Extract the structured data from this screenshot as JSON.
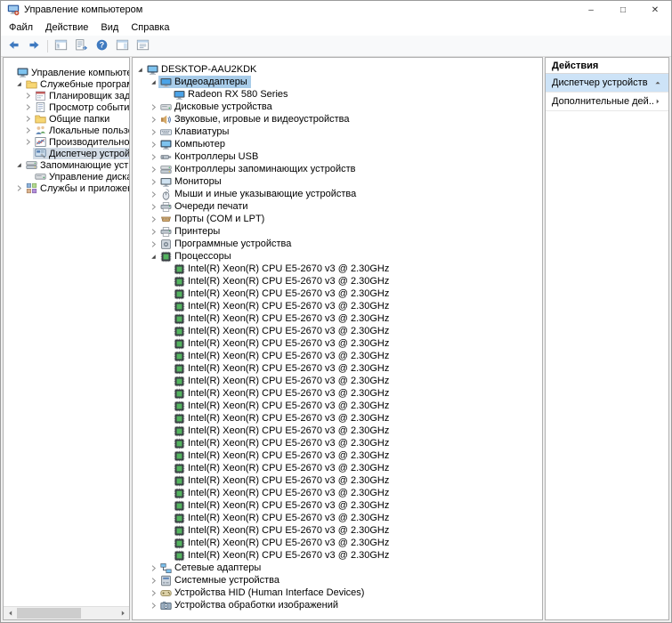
{
  "window": {
    "title": "Управление компьютером",
    "controls": {
      "minimize": "–",
      "maximize": "□",
      "close": "✕"
    }
  },
  "menubar": {
    "items": [
      {
        "name": "file",
        "label": "Файл"
      },
      {
        "name": "action",
        "label": "Действие"
      },
      {
        "name": "view",
        "label": "Вид"
      },
      {
        "name": "help",
        "label": "Справка"
      }
    ]
  },
  "toolbar": {
    "buttons": [
      {
        "name": "back",
        "icon": "arrow-left"
      },
      {
        "name": "forward",
        "icon": "arrow-right"
      },
      {
        "name": "show-console-tree",
        "icon": "window-tree"
      },
      {
        "name": "export-list",
        "icon": "export-list"
      },
      {
        "name": "help",
        "icon": "help"
      },
      {
        "name": "show-action-pane",
        "icon": "window-pane"
      },
      {
        "name": "properties",
        "icon": "window-props"
      }
    ]
  },
  "left_tree": {
    "items": [
      {
        "name": "computer-management-root",
        "label": "Управление компьютером (л",
        "level": 0,
        "chevron": "none",
        "icon": "computer",
        "selected": false
      },
      {
        "name": "system-tools",
        "label": "Служебные программы",
        "level": 1,
        "chevron": "expanded",
        "icon": "folder",
        "selected": false
      },
      {
        "name": "task-scheduler",
        "label": "Планировщик заданий",
        "level": 2,
        "chevron": "collapsed",
        "icon": "scheduler",
        "selected": false
      },
      {
        "name": "event-viewer",
        "label": "Просмотр событий",
        "level": 2,
        "chevron": "collapsed",
        "icon": "eventlog",
        "selected": false
      },
      {
        "name": "shared-folders",
        "label": "Общие папки",
        "level": 2,
        "chevron": "collapsed",
        "icon": "folder",
        "selected": false
      },
      {
        "name": "local-users-groups",
        "label": "Локальные пользовате",
        "level": 2,
        "chevron": "collapsed",
        "icon": "users",
        "selected": false
      },
      {
        "name": "performance",
        "label": "Производительность",
        "level": 2,
        "chevron": "collapsed",
        "icon": "perf",
        "selected": false
      },
      {
        "name": "device-manager",
        "label": "Диспетчер устройств",
        "level": 2,
        "chevron": "none",
        "icon": "devmgr",
        "selected": true
      },
      {
        "name": "storage-group",
        "label": "Запоминающие устройст",
        "level": 1,
        "chevron": "expanded",
        "icon": "storage",
        "selected": false
      },
      {
        "name": "disk-management",
        "label": "Управление дисками",
        "level": 2,
        "chevron": "none",
        "icon": "disk",
        "selected": false
      },
      {
        "name": "services-applications",
        "label": "Службы и приложения",
        "level": 1,
        "chevron": "collapsed",
        "icon": "services",
        "selected": false
      }
    ]
  },
  "device_tree": {
    "items": [
      {
        "name": "computer-root",
        "label": "DESKTOP-AAU2KDK",
        "level": 0,
        "chevron": "expanded",
        "icon": "computer",
        "selected": false
      },
      {
        "name": "display-adapters",
        "label": "Видеоадаптеры",
        "level": 1,
        "chevron": "expanded",
        "icon": "display",
        "selected": true
      },
      {
        "name": "radeon-rx-580",
        "label": "Radeon RX 580 Series",
        "level": 2,
        "chevron": "none",
        "icon": "display",
        "selected": false
      },
      {
        "name": "disk-drives",
        "label": "Дисковые устройства",
        "level": 1,
        "chevron": "collapsed",
        "icon": "disk",
        "selected": false
      },
      {
        "name": "sound-devices",
        "label": "Звуковые, игровые и видеоустройства",
        "level": 1,
        "chevron": "collapsed",
        "icon": "sound",
        "selected": false
      },
      {
        "name": "keyboards",
        "label": "Клавиатуры",
        "level": 1,
        "chevron": "collapsed",
        "icon": "keyboard",
        "selected": false
      },
      {
        "name": "computer-group",
        "label": "Компьютер",
        "level": 1,
        "chevron": "collapsed",
        "icon": "computer",
        "selected": false
      },
      {
        "name": "usb-controllers",
        "label": "Контроллеры USB",
        "level": 1,
        "chevron": "collapsed",
        "icon": "usb",
        "selected": false
      },
      {
        "name": "storage-controllers",
        "label": "Контроллеры запоминающих устройств",
        "level": 1,
        "chevron": "collapsed",
        "icon": "storage",
        "selected": false
      },
      {
        "name": "monitors",
        "label": "Мониторы",
        "level": 1,
        "chevron": "collapsed",
        "icon": "monitor",
        "selected": false
      },
      {
        "name": "mice",
        "label": "Мыши и иные указывающие устройства",
        "level": 1,
        "chevron": "collapsed",
        "icon": "mouse",
        "selected": false
      },
      {
        "name": "print-queues",
        "label": "Очереди печати",
        "level": 1,
        "chevron": "collapsed",
        "icon": "printer",
        "selected": false
      },
      {
        "name": "ports-com-lpt",
        "label": "Порты (COM и LPT)",
        "level": 1,
        "chevron": "collapsed",
        "icon": "ports",
        "selected": false
      },
      {
        "name": "printers",
        "label": "Принтеры",
        "level": 1,
        "chevron": "collapsed",
        "icon": "printer",
        "selected": false
      },
      {
        "name": "software-devices",
        "label": "Программные устройства",
        "level": 1,
        "chevron": "collapsed",
        "icon": "software",
        "selected": false
      },
      {
        "name": "processors",
        "label": "Процессоры",
        "level": 1,
        "chevron": "expanded",
        "icon": "cpu",
        "selected": false
      },
      {
        "name": "processor",
        "label": "Intel(R) Xeon(R) CPU E5-2670 v3 @ 2.30GHz",
        "level": 2,
        "chevron": "none",
        "icon": "cpu",
        "selected": false,
        "repeat": 24
      },
      {
        "name": "network-adapters",
        "label": "Сетевые адаптеры",
        "level": 1,
        "chevron": "collapsed",
        "icon": "network",
        "selected": false
      },
      {
        "name": "system-devices",
        "label": "Системные устройства",
        "level": 1,
        "chevron": "collapsed",
        "icon": "system",
        "selected": false
      },
      {
        "name": "hid-devices",
        "label": "Устройства HID (Human Interface Devices)",
        "level": 1,
        "chevron": "collapsed",
        "icon": "hid",
        "selected": false
      },
      {
        "name": "imaging-devices",
        "label": "Устройства обработки изображений",
        "level": 1,
        "chevron": "collapsed",
        "icon": "imaging",
        "selected": false
      }
    ]
  },
  "actions_pane": {
    "header": "Действия",
    "groups": [
      {
        "name": "device-manager-actions",
        "label": "Диспетчер устройств",
        "arrow": "up",
        "selected": true
      },
      {
        "name": "more-actions",
        "label": "Дополнительные дей...",
        "arrow": "right",
        "selected": false
      }
    ]
  }
}
